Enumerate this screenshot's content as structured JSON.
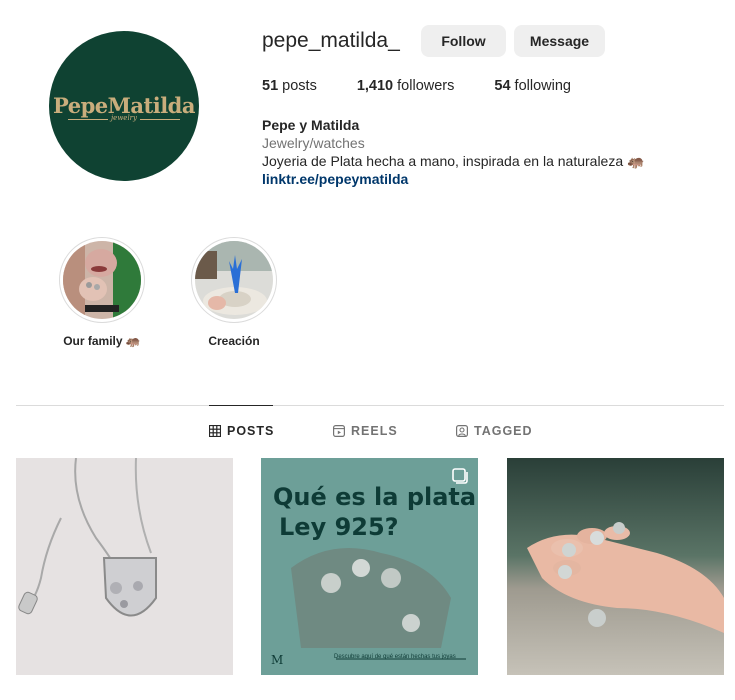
{
  "profile": {
    "username": "pepe_matilda_",
    "avatar_wordmark": "PepeMatilda",
    "avatar_sub": "jewelry",
    "follow_label": "Follow",
    "message_label": "Message",
    "posts_count": "51",
    "posts_label": " posts",
    "followers_count": "1,410",
    "followers_label": " followers",
    "following_count": "54",
    "following_label": " following",
    "full_name": "Pepe y Matilda",
    "category": "Jewelry/watches",
    "bio": "Joyeria de Plata hecha a mano, inspirada en la naturaleza 🦛",
    "link": "linktr.ee/pepeymatilda"
  },
  "highlights": [
    {
      "label": "Our family 🦛"
    },
    {
      "label": "Creación"
    }
  ],
  "tabs": {
    "posts": "POSTS",
    "reels": "REELS",
    "tagged": "TAGGED"
  },
  "posts": {
    "post2_title_line1": "Qué es la plata",
    "post2_title_line2": "Ley 925?",
    "post2_footer": "Descubre aquí de qué están hechas tus joyas"
  },
  "colors": {
    "brand": "#0f4232",
    "gold": "#c9ad7c",
    "link": "#00376b",
    "button_bg": "#efefef"
  },
  "icons": [
    "grid-icon",
    "reels-icon",
    "tagged-icon",
    "multi-post-icon"
  ]
}
